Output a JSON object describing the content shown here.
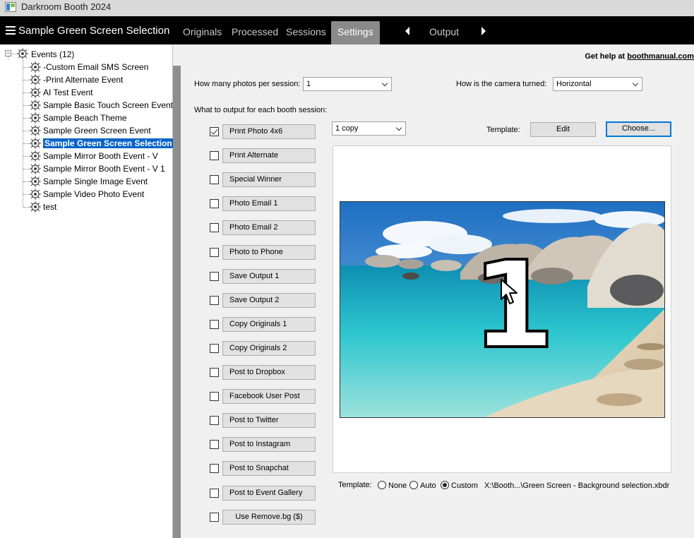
{
  "window": {
    "title": "Darkroom Booth 2024"
  },
  "navbar": {
    "event_name": "Sample Green Screen Selection",
    "tabs": [
      {
        "label": "Originals"
      },
      {
        "label": "Processed"
      },
      {
        "label": "Sessions"
      },
      {
        "label": "Settings",
        "active": true
      }
    ],
    "settings_page": "Output"
  },
  "tree": {
    "root_label": "Events (12)",
    "items": [
      {
        "label": "-Custom Email SMS Screen"
      },
      {
        "label": "-Print Alternate Event"
      },
      {
        "label": "AI Test Event"
      },
      {
        "label": "Sample Basic Touch Screen Event"
      },
      {
        "label": "Sample Beach Theme"
      },
      {
        "label": "Sample Green Screen Event"
      },
      {
        "label": "Sample Green Screen Selection",
        "selected": true
      },
      {
        "label": "Sample Mirror Booth Event - V"
      },
      {
        "label": "Sample Mirror Booth Event - V  1"
      },
      {
        "label": "Sample Single Image Event"
      },
      {
        "label": "Sample Video Photo Event"
      },
      {
        "label": "test"
      }
    ]
  },
  "help": {
    "prefix": "Get help at ",
    "link": "boothmanual.com"
  },
  "settings": {
    "photos_per_session_label": "How many photos per session:",
    "photos_per_session_value": "1",
    "camera_turned_label": "How is the camera turned:",
    "camera_turned_value": "Horizontal",
    "output_heading": "What to output for each booth session:",
    "copies_value": "1 copy",
    "template_label": "Template:",
    "edit_label": "Edit",
    "choose_label": "Choose...",
    "outputs": [
      {
        "label": "Print Photo  4x6",
        "checked": true
      },
      {
        "label": "Print Alternate",
        "checked": false
      },
      {
        "label": "Special Winner",
        "checked": false
      },
      {
        "label": "Photo Email 1",
        "checked": false
      },
      {
        "label": "Photo Email 2",
        "checked": false
      },
      {
        "label": "Photo to Phone",
        "checked": false
      },
      {
        "label": "Save Output 1",
        "checked": false
      },
      {
        "label": "Save Output 2",
        "checked": false
      },
      {
        "label": "Copy Originals 1",
        "checked": false
      },
      {
        "label": "Copy Originals 2",
        "checked": false
      },
      {
        "label": "Post to Dropbox",
        "checked": false
      },
      {
        "label": "Facebook User Post",
        "checked": false
      },
      {
        "label": "Post to Twitter",
        "checked": false
      },
      {
        "label": "Post to Instagram",
        "checked": false
      },
      {
        "label": "Post to Snapchat",
        "checked": false
      },
      {
        "label": "Post to Event Gallery",
        "checked": false
      },
      {
        "label": "Use Remove.bg ($)",
        "checked": false
      }
    ],
    "preview_countdown": "1",
    "template_mode_label": "Template:",
    "template_modes": [
      {
        "label": "None",
        "selected": false
      },
      {
        "label": "Auto",
        "selected": false
      },
      {
        "label": "Custom",
        "selected": true
      }
    ],
    "template_path": "X:\\Booth...\\Green Screen - Background selection.xbdr"
  }
}
